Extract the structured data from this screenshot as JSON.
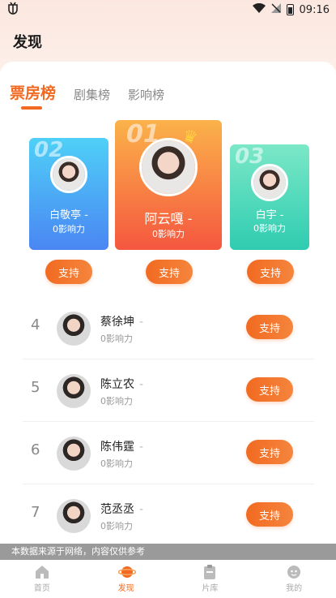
{
  "status_bar": {
    "time": "09:16",
    "app_icon": "app-bug-icon"
  },
  "header": {
    "title": "发现"
  },
  "tabs": [
    {
      "label": "票房榜",
      "active": true
    },
    {
      "label": "剧集榜",
      "active": false
    },
    {
      "label": "影响榜",
      "active": false
    }
  ],
  "podium": {
    "first": {
      "rank": "01",
      "name": "阿云嘎",
      "dash": "-",
      "influence": "0影响力"
    },
    "second": {
      "rank": "02",
      "name": "白敬亭",
      "dash": "-",
      "influence": "0影响力"
    },
    "third": {
      "rank": "03",
      "name": "白宇",
      "dash": "-",
      "influence": "0影响力"
    }
  },
  "support_label": "支持",
  "list": [
    {
      "rank": "4",
      "name": "蔡徐坤",
      "dash": "-",
      "influence": "0影响力"
    },
    {
      "rank": "5",
      "name": "陈立农",
      "dash": "-",
      "influence": "0影响力"
    },
    {
      "rank": "6",
      "name": "陈伟霆",
      "dash": "-",
      "influence": "0影响力"
    },
    {
      "rank": "7",
      "name": "范丞丞",
      "dash": "-",
      "influence": "0影响力"
    }
  ],
  "disclaimer": "本数据来源于网络，内容仅供参考",
  "nav": [
    {
      "label": "首页",
      "icon": "home-icon",
      "active": false
    },
    {
      "label": "发现",
      "icon": "planet-icon",
      "active": true
    },
    {
      "label": "片库",
      "icon": "clipboard-icon",
      "active": false
    },
    {
      "label": "我的",
      "icon": "profile-icon",
      "active": false
    }
  ],
  "colors": {
    "accent": "#f26a21",
    "second_card": "#4a86f3",
    "first_card": "#f5573f",
    "third_card": "#2fccb1"
  }
}
